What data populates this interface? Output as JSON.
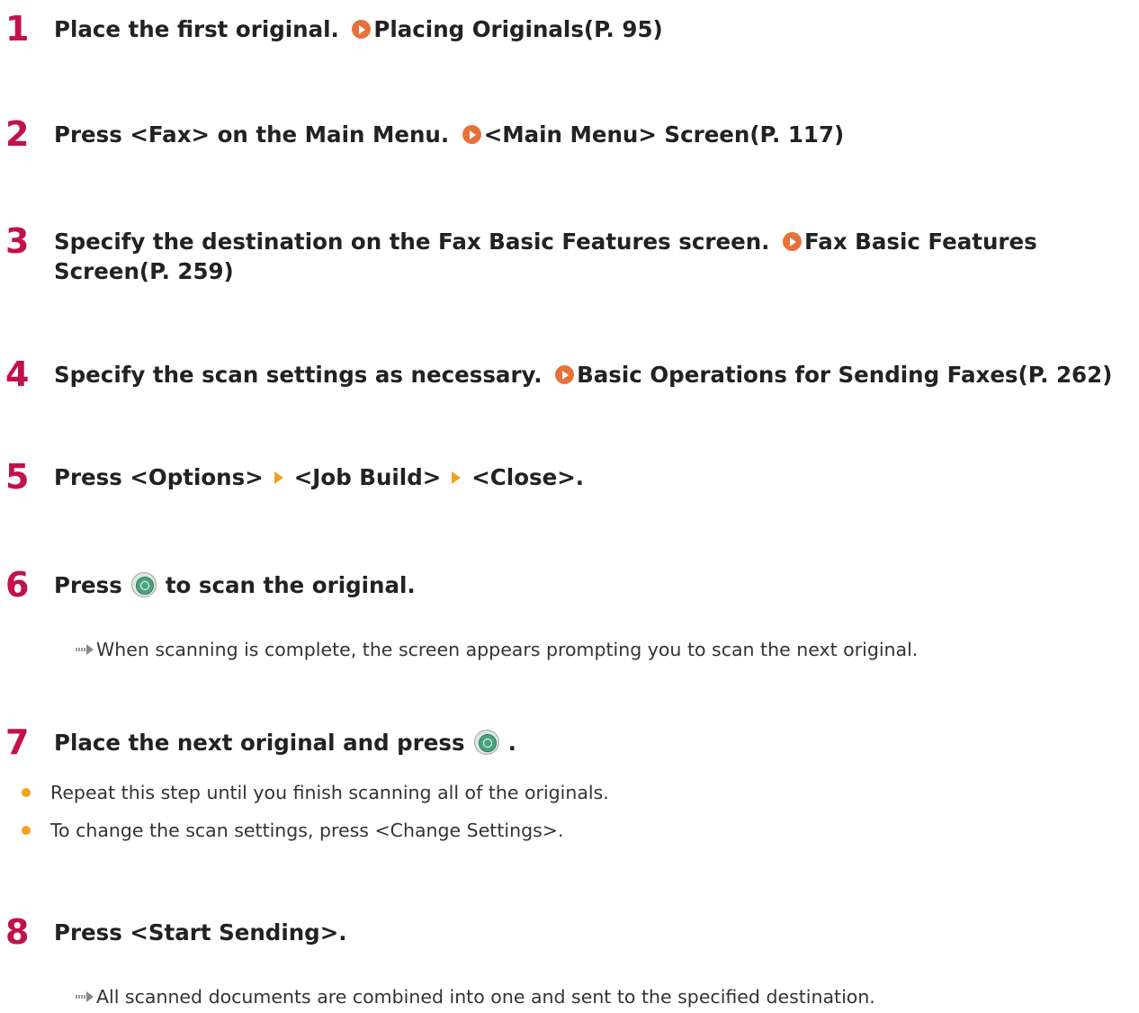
{
  "steps": [
    {
      "number": "1",
      "text": "Place the first original.",
      "link": "Placing Originals(P. 95)"
    },
    {
      "number": "2",
      "text": "Press <Fax> on the Main Menu.",
      "link": "<Main Menu> Screen(P. 117)"
    },
    {
      "number": "3",
      "text": "Specify the destination on the Fax Basic Features screen.",
      "link_line1": "Fax Basic Features",
      "link_line2": "Screen(P. 259)"
    },
    {
      "number": "4",
      "text": "Specify the scan settings as necessary.",
      "link": "Basic Operations for Sending Faxes(P. 262)"
    },
    {
      "number": "5",
      "text_parts": [
        "Press <Options>",
        "<Job Build>",
        "<Close>."
      ]
    },
    {
      "number": "6",
      "text_before": "Press",
      "text_after": "to scan the original.",
      "result": "When scanning is complete, the screen appears prompting you to scan the next original."
    },
    {
      "number": "7",
      "text_before": "Place the next original and press",
      "text_after": ".",
      "bullets": [
        "Repeat this step until you finish scanning all of the originals.",
        "To change the scan settings, press <Change Settings>."
      ]
    },
    {
      "number": "8",
      "text": "Press <Start Sending>.",
      "result": "All scanned documents are combined into one and sent to the specified destination."
    }
  ],
  "icons": {
    "link": "link-arrow-icon",
    "separator": "menu-separator-icon",
    "start": "start-button-icon",
    "result": "result-arrow-icon",
    "bullet": "bullet-icon"
  },
  "colors": {
    "step_number": "#c2114d",
    "link_icon": "#e8703a",
    "separator": "#f5a020",
    "bullet": "#f5a020",
    "start_button": "#4aa380"
  }
}
